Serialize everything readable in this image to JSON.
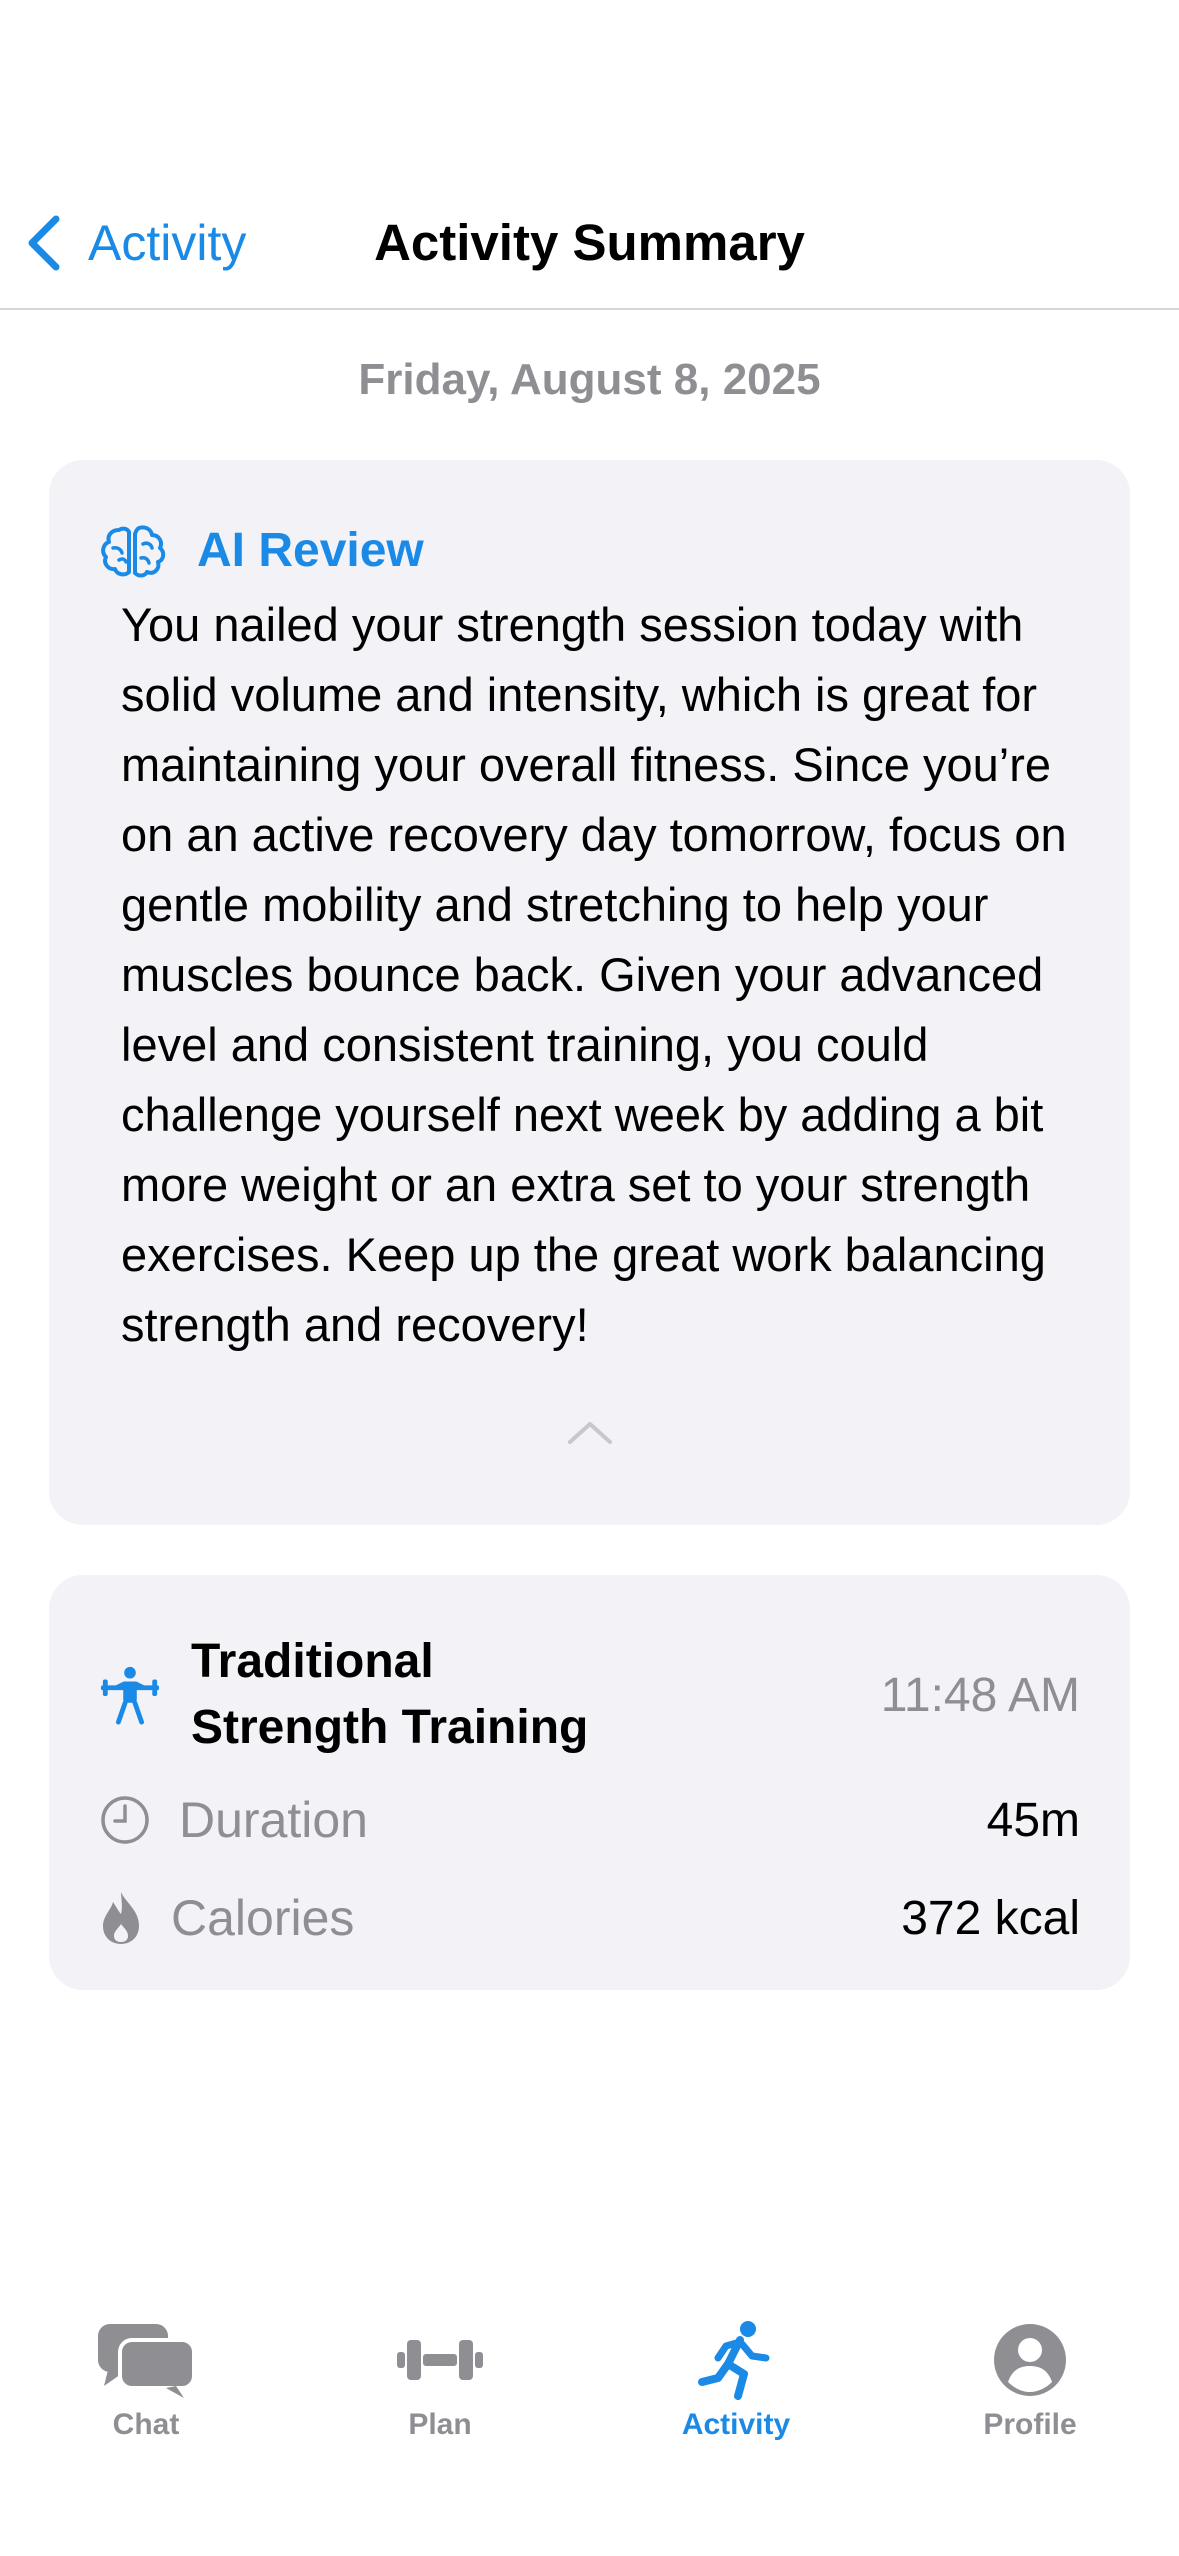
{
  "nav": {
    "back_label": "Activity",
    "title": "Activity Summary"
  },
  "date": "Friday, August 8, 2025",
  "ai_review": {
    "title": "AI Review",
    "icon": "brain-icon",
    "text": "You nailed your strength session today with solid volume and intensity, which is great for maintaining your overall fitness. Since you’re on an active recovery day tomorrow, focus on gentle mobility and stretching to help your muscles bounce back. Given your advanced level and consistent training, you could challenge yourself next week by adding a bit more weight or an extra set to your strength exercises. Keep up the great work balancing strength and recovery!"
  },
  "workout": {
    "icon": "weightlifter-icon",
    "title_line1": "Traditional",
    "title_line2": "Strength Training",
    "time": "11:48 AM",
    "duration_label": "Duration",
    "duration_value": "45m",
    "calories_label": "Calories",
    "calories_value": "372 kcal"
  },
  "tabs": [
    {
      "label": "Chat",
      "icon": "chat-bubbles-icon",
      "active": false
    },
    {
      "label": "Plan",
      "icon": "dumbbell-icon",
      "active": false
    },
    {
      "label": "Activity",
      "icon": "running-figure-icon",
      "active": true
    },
    {
      "label": "Profile",
      "icon": "person-circle-icon",
      "active": false
    }
  ],
  "colors": {
    "accent": "#1a8ae6",
    "secondary_text": "#8e8e93",
    "card_bg": "#f2f2f7",
    "inactive_tab": "#8e8e93"
  }
}
